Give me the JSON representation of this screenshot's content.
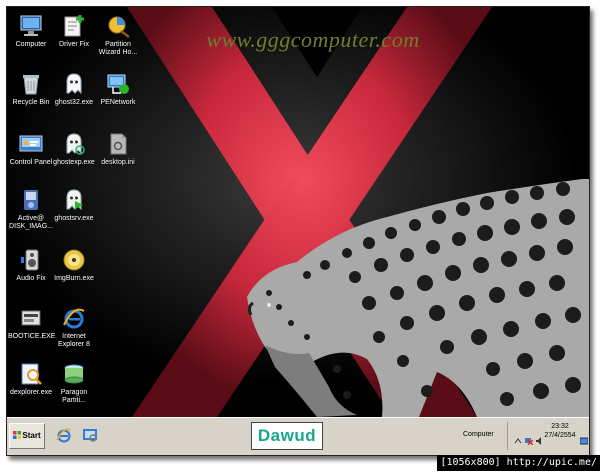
{
  "desktop": {
    "watermark": "www.gggcomputer.com",
    "icons": [
      {
        "label": "Computer",
        "icon": "computer-icon"
      },
      {
        "label": "Driver Fix",
        "icon": "driver-fix-icon"
      },
      {
        "label": "Partition\nWizard Ho...",
        "icon": "partition-wizard-icon"
      },
      {
        "label": "Recycle Bin",
        "icon": "recycle-bin-icon"
      },
      {
        "label": "ghost32.exe",
        "icon": "ghost-icon"
      },
      {
        "label": "PENetwork",
        "icon": "penetwork-icon"
      },
      {
        "label": "Control Panel",
        "icon": "control-panel-icon"
      },
      {
        "label": "ghostexp.exe",
        "icon": "ghost-icon"
      },
      {
        "label": "desktop.ini",
        "icon": "ini-file-icon"
      },
      {
        "label": "Active@\nDISK_IMAG...",
        "icon": "disk-image-icon"
      },
      {
        "label": "ghostsrv.exe",
        "icon": "ghost-icon"
      },
      {
        "label": "Audio Fix",
        "icon": "audio-fix-icon"
      },
      {
        "label": "ImgBurn.exe",
        "icon": "imgburn-icon"
      },
      {
        "label": "BOOTICE.EXE",
        "icon": "bootice-icon"
      },
      {
        "label": "Internet\nExplorer 8",
        "icon": "internet-explorer-icon"
      },
      {
        "label": "dexplorer.exe",
        "icon": "dexplorer-icon"
      },
      {
        "label": "Paragon\nPartiti...",
        "icon": "paragon-icon"
      }
    ]
  },
  "taskbar": {
    "start_label": "Start",
    "brand": "Dawud",
    "task_item": "Computer",
    "clock_time": "23:32",
    "clock_date": "27/4/2554"
  },
  "footer": {
    "credit": "[1056x800] http://upic.me/"
  },
  "colors": {
    "x_red": "#c8283c",
    "watermark": "#6e7f2c",
    "brand_text": "#18a889",
    "taskbar": "#d7d3c8"
  }
}
